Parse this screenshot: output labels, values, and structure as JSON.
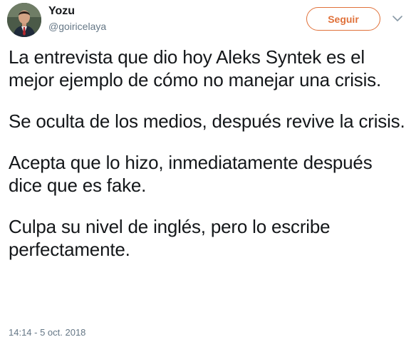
{
  "user": {
    "display_name": "Yozu",
    "handle": "@goiricelaya",
    "avatar_icon": "profile-photo"
  },
  "actions": {
    "follow_label": "Seguir",
    "menu_icon": "chevron-down-icon",
    "accent_color": "#e0713a"
  },
  "tweet": {
    "paragraphs": [
      "La entrevista que dio hoy Aleks Syntek es el mejor ejemplo de cómo no manejar una crisis.",
      "Se oculta de los medios, después revive la crisis.",
      "Acepta que lo hizo, inmediatamente después dice que es fake.",
      "Culpa su nivel de inglés, pero lo escribe perfectamente."
    ],
    "timestamp": "14:14 - 5 oct. 2018"
  }
}
